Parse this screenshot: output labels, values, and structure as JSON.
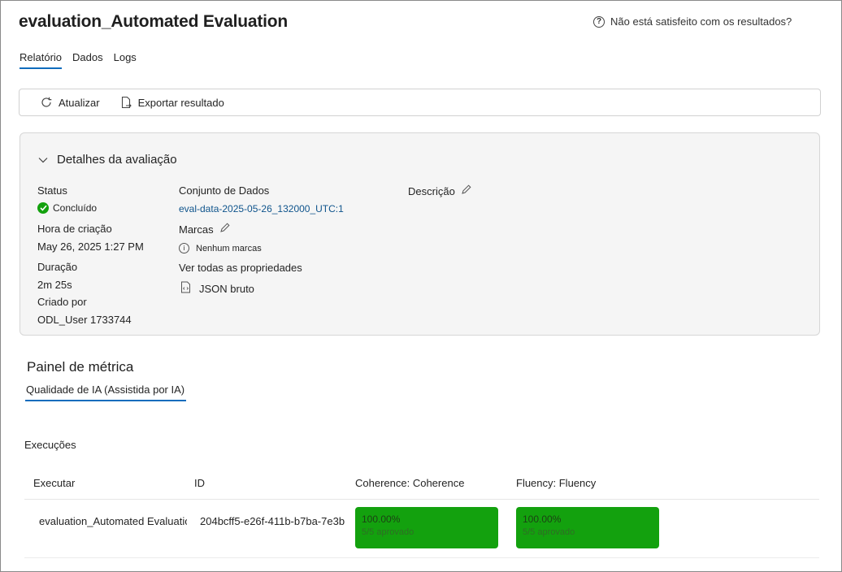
{
  "header": {
    "title": "evaluation_Automated Evaluation",
    "help_text": "Não está satisfeito com os resultados?"
  },
  "tabs": [
    {
      "label": "Relatório",
      "active": true
    },
    {
      "label": "Dados",
      "active": false
    },
    {
      "label": "Logs",
      "active": false
    }
  ],
  "toolbar": {
    "refresh_label": "Atualizar",
    "export_label": "Exportar resultado"
  },
  "details": {
    "heading": "Detalhes da avaliação",
    "status_label": "Status",
    "status_value": "Concluído",
    "created_label": "Hora de criação",
    "created_value": "May 26, 2025 1:27 PM",
    "duration_label": "Duração",
    "duration_value": "2m 25s",
    "created_by_label": "Criado por",
    "created_by_value": "ODL_User 1733744",
    "dataset_label": "Conjunto de Dados",
    "dataset_value": "eval-data-2025-05-26_132000_UTC:1",
    "tags_label": "Marcas",
    "tags_value": "Nenhum marcas",
    "all_props_label": "Ver todas as propriedades",
    "raw_json_label": "JSON bruto",
    "description_label": "Descrição"
  },
  "metrics": {
    "title": "Painel de métrica",
    "tab_label": "Qualidade de IA (Assistida por IA)"
  },
  "runs": {
    "label": "Execuções",
    "columns": [
      "Executar",
      "ID",
      "Coherence: Coherence",
      "Fluency: Fluency"
    ],
    "rows": [
      {
        "run": "evaluation_Automated Evaluation",
        "id": "204bcff5-e26f-411b-b7ba-7e3b",
        "coherence_pct": "100.00%",
        "coherence_sub": "5/5 aprovado",
        "fluency_pct": "100.00%",
        "fluency_sub": "5/5 aprovado"
      }
    ]
  },
  "colors": {
    "accent": "#0f6cbd",
    "success": "#13a10e",
    "link": "#0f548c"
  }
}
